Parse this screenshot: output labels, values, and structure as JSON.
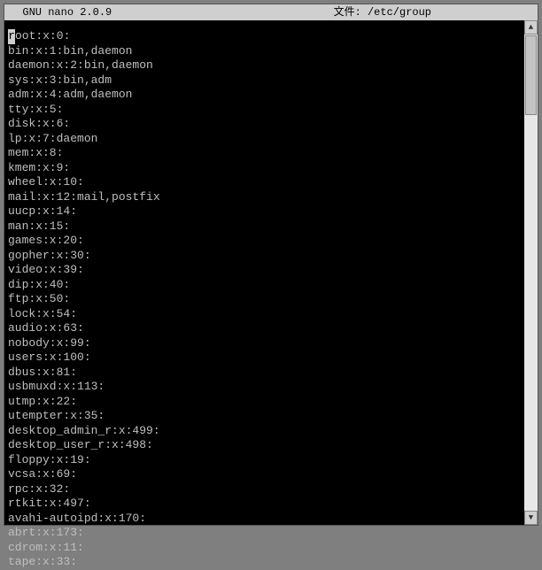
{
  "titlebar": {
    "app_name": "GNU nano",
    "app_version": "2.0.9",
    "file_label": "文件:",
    "file_path": "/etc/group"
  },
  "cursor": {
    "line": 0,
    "char": "r"
  },
  "lines": [
    "root:x:0:",
    "bin:x:1:bin,daemon",
    "daemon:x:2:bin,daemon",
    "sys:x:3:bin,adm",
    "adm:x:4:adm,daemon",
    "tty:x:5:",
    "disk:x:6:",
    "lp:x:7:daemon",
    "mem:x:8:",
    "kmem:x:9:",
    "wheel:x:10:",
    "mail:x:12:mail,postfix",
    "uucp:x:14:",
    "man:x:15:",
    "games:x:20:",
    "gopher:x:30:",
    "video:x:39:",
    "dip:x:40:",
    "ftp:x:50:",
    "lock:x:54:",
    "audio:x:63:",
    "nobody:x:99:",
    "users:x:100:",
    "dbus:x:81:",
    "usbmuxd:x:113:",
    "utmp:x:22:",
    "utempter:x:35:",
    "desktop_admin_r:x:499:",
    "desktop_user_r:x:498:",
    "floppy:x:19:",
    "vcsa:x:69:",
    "rpc:x:32:",
    "rtkit:x:497:",
    "avahi-autoipd:x:170:",
    "abrt:x:173:",
    "cdrom:x:11:",
    "tape:x:33:"
  ]
}
